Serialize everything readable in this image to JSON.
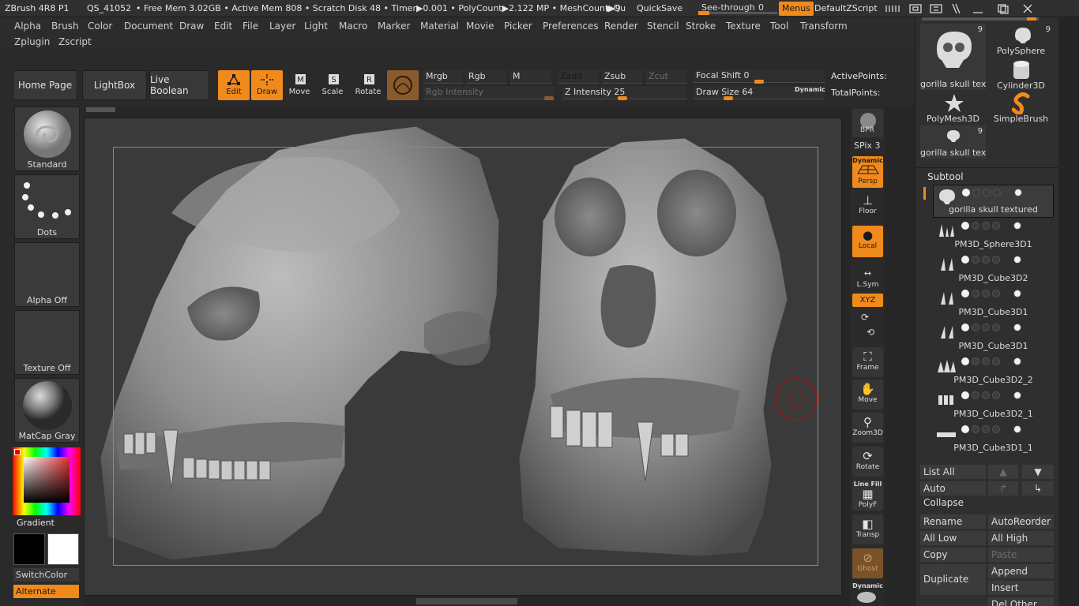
{
  "titlebar": {
    "app": "ZBrush 4R8 P1",
    "qs": "QS_41052",
    "stats": "• Free Mem 3.02GB • Active Mem 808 • Scratch Disk 48 • Timer▶0.001 • PolyCount▶2.122 MP • MeshCount▶9",
    "qu": "▶Qu",
    "quicksave": "QuickSave",
    "seethrough_label": "See-through",
    "seethrough_value": "0",
    "seethrough_level": 0,
    "menus": "Menus",
    "script": "DefaultZScript"
  },
  "menubar": {
    "row1": [
      "Alpha",
      "Brush",
      "Color",
      "Document",
      "Draw",
      "Edit",
      "File",
      "Layer",
      "Light",
      "Macro",
      "Marker",
      "Material",
      "Movie",
      "Picker",
      "Preferences",
      "Render",
      "Stencil",
      "Stroke",
      "Texture",
      "Tool",
      "Transform"
    ],
    "row2": [
      "Zplugin",
      "Zscript"
    ]
  },
  "shelf": {
    "home_page": "Home Page",
    "lightbox": "LightBox",
    "live_boolean": "Live Boolean",
    "modes": [
      {
        "label": "Edit",
        "on": true
      },
      {
        "label": "Draw",
        "on": true
      },
      {
        "label": "Move",
        "on": false
      },
      {
        "label": "Scale",
        "on": false
      },
      {
        "label": "Rotate",
        "on": false
      }
    ],
    "mrgb": "Mrgb",
    "rgb": "Rgb",
    "m": "M",
    "zadd": "Zadd",
    "zsub": "Zsub",
    "zcut": "Zcut",
    "rgb_intensity": "Rgb Intensity",
    "z_intensity_label": "Z Intensity",
    "z_intensity": "25",
    "focal_shift_label": "Focal Shift",
    "focal_shift": "0",
    "draw_size_label": "Draw Size",
    "draw_size": "64",
    "dynamic": "Dynamic",
    "active_points": "ActivePoints:",
    "total_points": "TotalPoints:"
  },
  "lefttray": {
    "brush": "Standard",
    "stroke": "Dots",
    "alpha": "Alpha Off",
    "texture": "Texture Off",
    "material": "MatCap Gray",
    "gradient": "Gradient",
    "switchcolor": "SwitchColor",
    "alternate": "Alternate"
  },
  "rightdock": {
    "bpr": "BPR",
    "spix_label": "SPix",
    "spix": "3",
    "dynamic": "Dynamic",
    "persp": "Persp",
    "floor": "Floor",
    "local": "Local",
    "lsym": "L.Sym",
    "xyz": "XYZ",
    "frame": "Frame",
    "move": "Move",
    "zoom3d": "Zoom3D",
    "rotate": "Rotate",
    "polyf": "PolyF",
    "line_fill": "Line Fill",
    "transp": "Transp",
    "ghost": "Ghost",
    "solo_dynamic": "Dynamic"
  },
  "toolpanel": {
    "tiles": [
      {
        "name": "gorilla skull text",
        "count": "9"
      },
      {
        "name": "PolySphere",
        "count": "9"
      },
      {
        "name": "Cylinder3D",
        "count": ""
      },
      {
        "name": "PolyMesh3D",
        "count": ""
      },
      {
        "name": "SimpleBrush",
        "count": ""
      },
      {
        "name": "gorilla skull text",
        "count": "9"
      }
    ],
    "subtool_title": "Subtool",
    "subtools": [
      "gorilla skull textured",
      "PM3D_Sphere3D1",
      "PM3D_Cube3D2",
      "PM3D_Cube3D1",
      "PM3D_Cube3D1",
      "PM3D_Cube3D2_2",
      "PM3D_Cube3D2_1",
      "PM3D_Cube3D1_1"
    ],
    "list_all": "List All",
    "auto_collapse": "Auto Collapse",
    "rename": "Rename",
    "autoreorder": "AutoReorder",
    "all_low": "All Low",
    "all_high": "All High",
    "copy": "Copy",
    "paste": "Paste",
    "duplicate": "Duplicate",
    "append": "Append",
    "insert": "Insert",
    "del_other": "Del Other"
  }
}
